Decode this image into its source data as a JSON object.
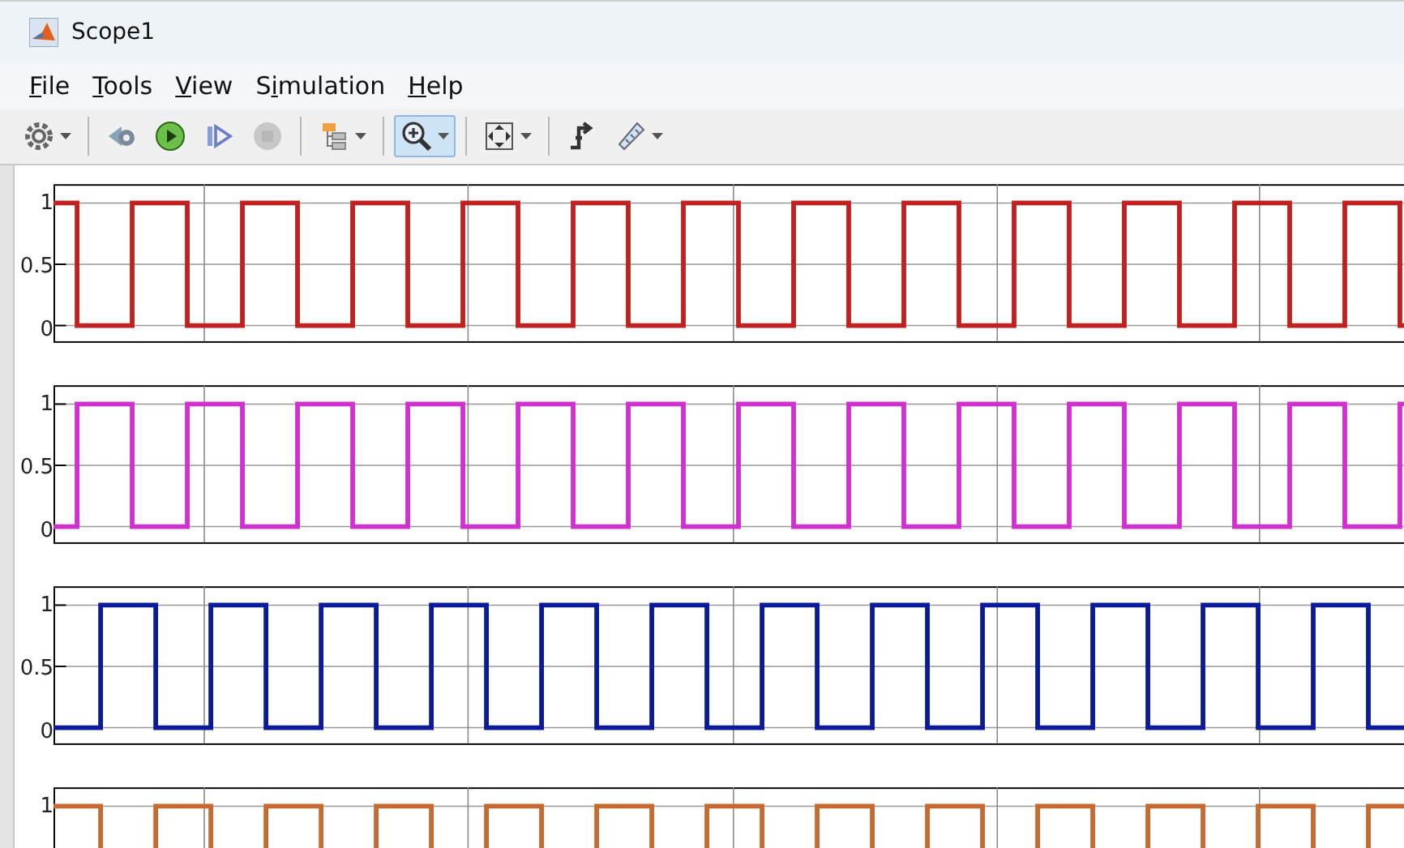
{
  "window": {
    "title": "Scope1"
  },
  "menu": [
    {
      "accel": "F",
      "rest": "ile"
    },
    {
      "accel": "T",
      "rest": "ools"
    },
    {
      "accel": "V",
      "rest": "iew"
    },
    {
      "lead": "S",
      "accel": "i",
      "rest": "mulation"
    },
    {
      "accel": "H",
      "rest": "elp"
    }
  ],
  "toolbar": [
    {
      "kind": "gear",
      "selected": false,
      "has_menu": true
    },
    {
      "kind": "separator"
    },
    {
      "kind": "step-back",
      "selected": false
    },
    {
      "kind": "run",
      "selected": false
    },
    {
      "kind": "step-forward",
      "selected": false
    },
    {
      "kind": "stop",
      "selected": false,
      "disabled": true
    },
    {
      "kind": "separator"
    },
    {
      "kind": "hierarchy",
      "selected": false,
      "has_menu": true
    },
    {
      "kind": "separator"
    },
    {
      "kind": "zoom",
      "selected": true,
      "has_menu": true
    },
    {
      "kind": "separator"
    },
    {
      "kind": "fit",
      "selected": false,
      "has_menu": true
    },
    {
      "kind": "separator"
    },
    {
      "kind": "trigger",
      "selected": false
    },
    {
      "kind": "ruler",
      "selected": false,
      "has_menu": true
    }
  ],
  "plots": [
    {
      "color": "#c0201e",
      "ytick_labels": [
        "1",
        "0.5",
        "0"
      ]
    },
    {
      "color": "#d030d0",
      "ytick_labels": [
        "1",
        "0.5",
        "0"
      ]
    },
    {
      "color": "#0a1a9a",
      "ytick_labels": [
        "1",
        "0.5",
        "0"
      ]
    },
    {
      "color": "#c86a30",
      "ytick_labels": [
        "1"
      ]
    }
  ]
}
